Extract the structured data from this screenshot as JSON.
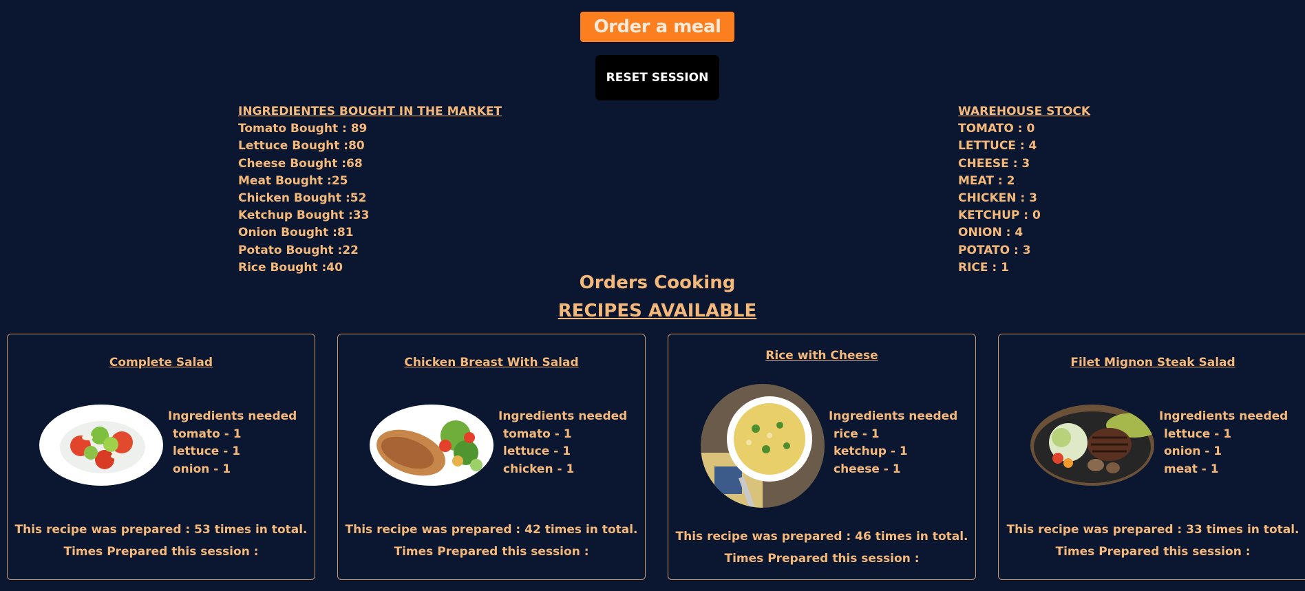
{
  "header": {
    "order_button": "Order a meal",
    "reset_button": "RESET SESSION"
  },
  "market": {
    "heading": "INGREDIENTES BOUGHT IN THE MARKET",
    "items": [
      "Tomato Bought : 89",
      "Lettuce Bought :80",
      "Cheese Bought :68",
      "Meat Bought :25",
      "Chicken Bought :52",
      "Ketchup Bought :33",
      "Onion Bought :81",
      "Potato Bought :22",
      "Rice Bought :40"
    ]
  },
  "warehouse": {
    "heading": "WAREHOUSE STOCK",
    "items": [
      "TOMATO : 0",
      "LETTUCE : 4",
      "CHEESE : 3",
      "MEAT : 2",
      "CHICKEN : 3",
      "KETCHUP : 0",
      "ONION : 4",
      "POTATO : 3",
      "RICE : 1"
    ]
  },
  "orders_cooking": "Orders Cooking",
  "recipes_title": "RECIPES AVAILABLE",
  "recipes": [
    {
      "title": "Complete Salad",
      "ingredients_heading": "Ingredients needed",
      "ingredients": [
        "tomato - 1",
        "lettuce - 1",
        "onion - 1"
      ],
      "prepared_total": "This recipe was prepared : 53 times in total.",
      "prepared_session": "Times Prepared this session :"
    },
    {
      "title": "Chicken Breast With Salad",
      "ingredients_heading": "Ingredients needed",
      "ingredients": [
        "tomato - 1",
        "lettuce - 1",
        "chicken - 1"
      ],
      "prepared_total": "This recipe was prepared : 42 times in total.",
      "prepared_session": "Times Prepared this session :"
    },
    {
      "title": "Rice with Cheese",
      "ingredients_heading": "Ingredients needed",
      "ingredients": [
        "rice - 1",
        "ketchup - 1",
        "cheese - 1"
      ],
      "prepared_total": "This recipe was prepared : 46 times in total.",
      "prepared_session": "Times Prepared this session :"
    },
    {
      "title": "Filet Mignon Steak Salad",
      "ingredients_heading": "Ingredients needed",
      "ingredients": [
        "lettuce - 1",
        "onion - 1",
        "meat - 1"
      ],
      "prepared_total": "This recipe was prepared : 33 times in total.",
      "prepared_session": "Times Prepared this session :"
    }
  ]
}
